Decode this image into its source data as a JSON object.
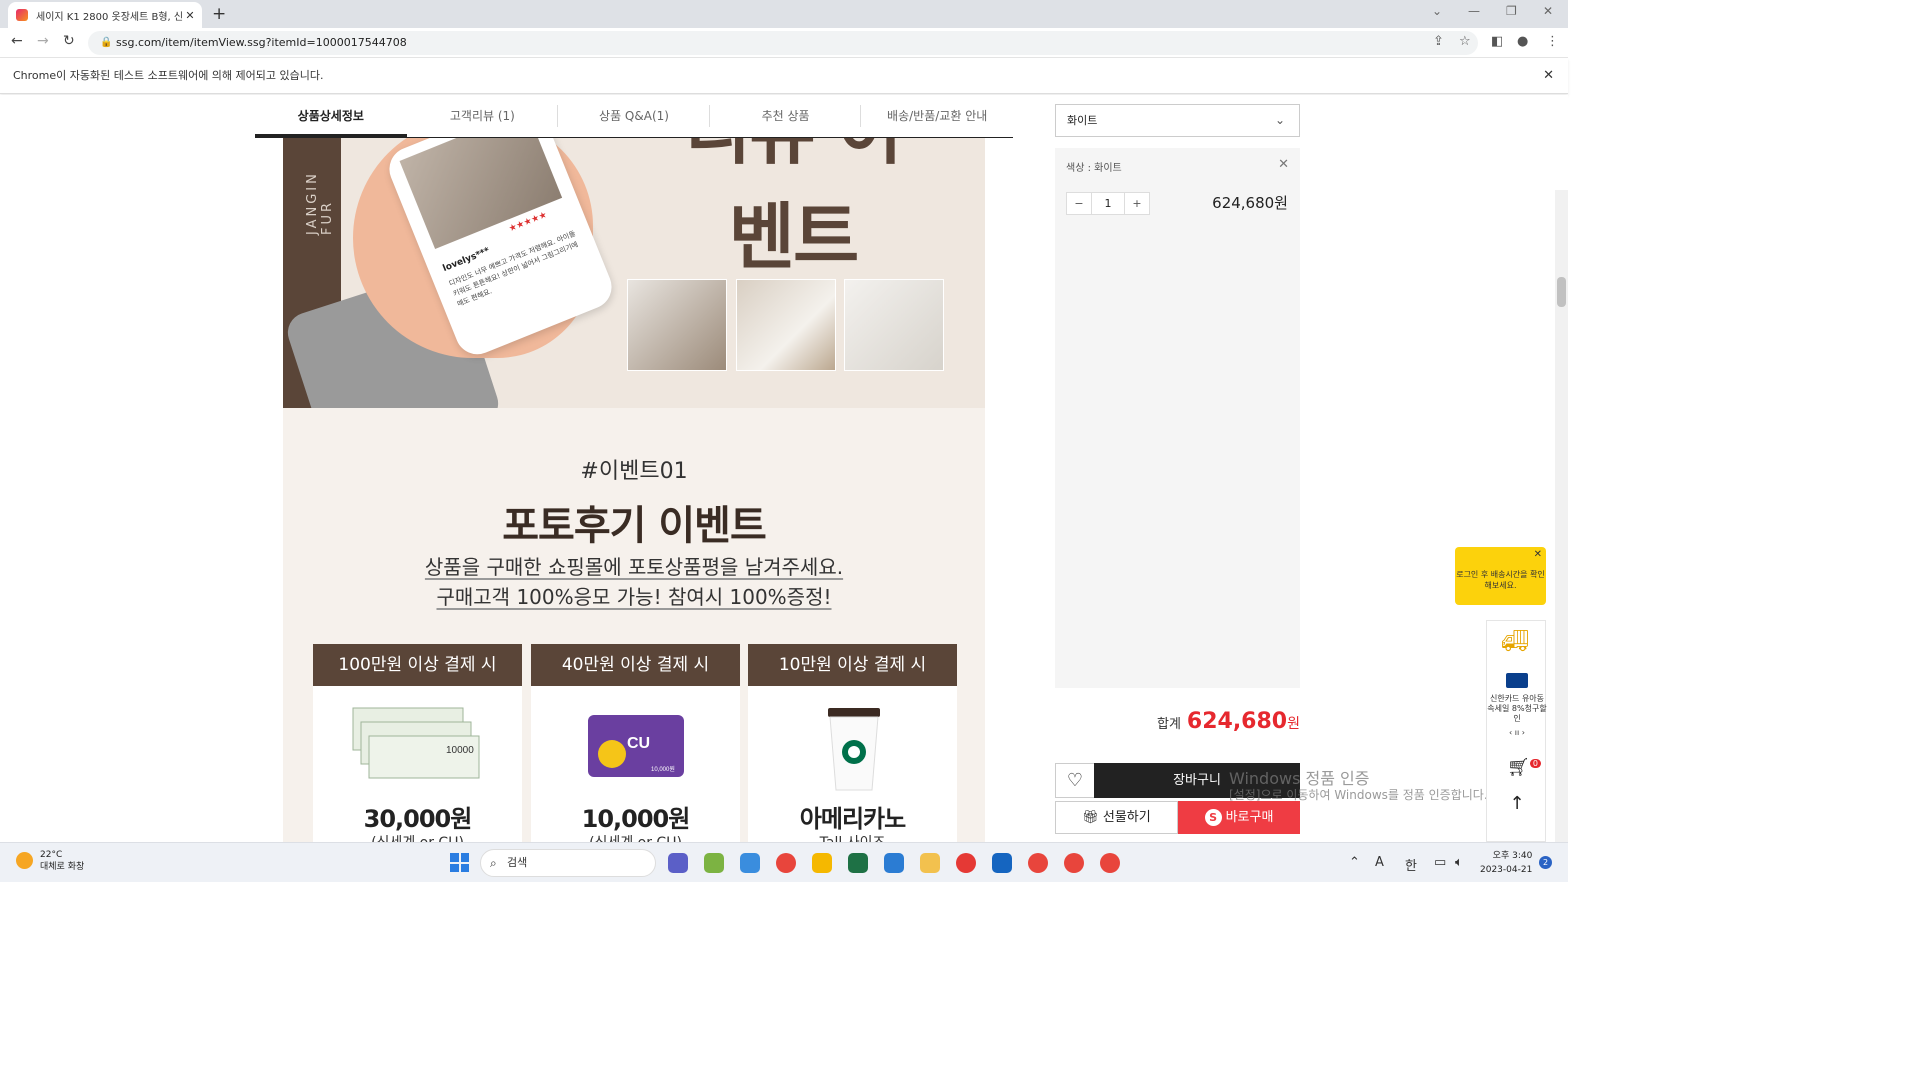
{
  "browser": {
    "tab_title": "세이지 K1 2800 옷장세트 B형, 신",
    "tab_close": "✕",
    "new_tab": "+",
    "url": "ssg.com/item/itemView.ssg?itemId=1000017544708",
    "infobar_text": "Chrome이 자동화된 테스트 소프트웨어에 의해 제어되고 있습니다.",
    "infobar_close": "✕"
  },
  "product_tabs": [
    "상품상세정보",
    "고객리뷰 (1)",
    "상품 Q&A(1)",
    "추천 상품",
    "배송/반품/교환 안내"
  ],
  "banner": {
    "vertical_text": "JANGIN FUR",
    "big_text": "리뷰 이벤트",
    "review_stars": "★★★★★",
    "review_nick": "lovelys***",
    "review_text": "디자인도 너무 예쁘고 가격도 저렴해요. 아이들 키워도 튼튼해요! 상판이 넓어서 그림그리기에 매도 편해요."
  },
  "event": {
    "tag": "#이벤트01",
    "title": "포토후기 이벤트",
    "line1": "상품을 구매한 쇼핑몰에 포토상품평을 남겨주세요.",
    "line2": "구매고객 100%응모 가능! 참여시 100%증정!",
    "cards": [
      {
        "head": "100만원 이상 결제 시",
        "amount": "30,000원",
        "sub": "(신세계 or CU)",
        "visual": "voucher",
        "voucher_amount": "10000"
      },
      {
        "head": "40만원 이상 결제 시",
        "amount": "10,000원",
        "sub": "(신세계 or CU)",
        "visual": "cu-card",
        "card_logo": "CU",
        "card_value": "10,000원"
      },
      {
        "head": "10만원 이상 결제 시",
        "amount": "아메리카노",
        "sub": "Tall 사이즈",
        "visual": "coffee"
      }
    ]
  },
  "order": {
    "option_selected": "화이트",
    "selected_label": "색상 : 화이트",
    "quantity": "1",
    "minus": "−",
    "plus": "+",
    "item_price": "624,680원",
    "total_label": "합계",
    "total_value": "624,680",
    "total_unit": "원",
    "cart_label": "장바구니",
    "gift_label": "선물하기",
    "buy_label": "바로구매"
  },
  "watermark": {
    "line1": "Windows 정품 인증",
    "line2": "[설정]으로 이동하여 Windows를 정품 인증합니다."
  },
  "side": {
    "tooltip": "로그인 후 배송시간을 확인해보세요.",
    "card_promo": "신한카드 유아동속세일 8%청구할인",
    "cart_count": "0",
    "pager": "‹ ıı ›"
  },
  "taskbar": {
    "temp": "22°C",
    "weather": "대체로 화창",
    "search_placeholder": "검색",
    "ime_a": "A",
    "ime_han": "한",
    "ampm_time": "오후 3:40",
    "date": "2023-04-21",
    "notifications": "2"
  },
  "colors": {
    "brand_brown": "#5a4538",
    "accent_red": "#e6282e",
    "buy_red": "#ef3c43",
    "tooltip_yellow": "#fcd20c"
  }
}
